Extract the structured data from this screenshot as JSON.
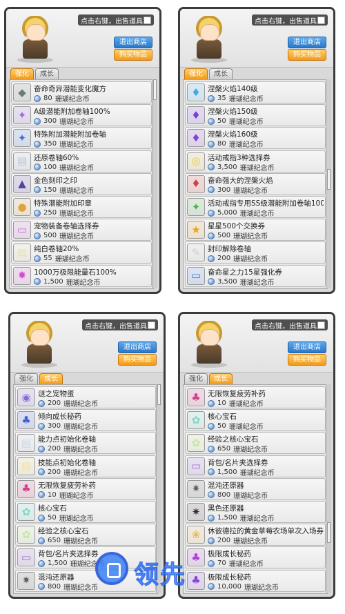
{
  "panels": [
    {
      "hint": "点击右键，出售道具",
      "exit_label": "退出商店",
      "buy_label": "购买物品",
      "tabs": [
        "强化",
        "成长"
      ],
      "active_tab": 0,
      "items": [
        {
          "name": "奋命奇异潜能变化魔方",
          "price": "80",
          "currency": "珊瑚纪念币",
          "icon": "cube-icon",
          "color": "#6b7c7a",
          "glyph": "◆"
        },
        {
          "name": "A级潜能附加卷轴100%",
          "price": "300",
          "currency": "珊瑚纪念币",
          "icon": "scroll-icon",
          "color": "#9b6bd6",
          "glyph": "✦"
        },
        {
          "name": "特殊附加潜能附加卷轴",
          "price": "350",
          "currency": "珊瑚纪念币",
          "icon": "scroll-icon",
          "color": "#3f6fd6",
          "glyph": "✦"
        },
        {
          "name": "还原卷轴60%",
          "price": "100",
          "currency": "珊瑚纪念币",
          "icon": "scroll-icon",
          "color": "#b9c4d8",
          "glyph": "▤"
        },
        {
          "name": "金色刻印之印",
          "price": "150",
          "currency": "珊瑚纪念币",
          "icon": "stamp-icon",
          "color": "#5a3fa0",
          "glyph": "▲"
        },
        {
          "name": "特殊潜能附加印章",
          "price": "250",
          "currency": "珊瑚纪念币",
          "icon": "stamp-icon",
          "color": "#e0a23c",
          "glyph": "●"
        },
        {
          "name": "宠物装备卷轴选择券",
          "price": "500",
          "currency": "珊瑚纪念币",
          "icon": "ticket-icon",
          "color": "#c86bd6",
          "glyph": "▭"
        },
        {
          "name": "纯白卷轴20%",
          "price": "55",
          "currency": "珊瑚纪念币",
          "icon": "scroll-icon",
          "color": "#e6e0b0",
          "glyph": "▤"
        },
        {
          "name": "1000万极限能量石100%",
          "price": "1,500",
          "currency": "珊瑚纪念币",
          "icon": "gem-icon",
          "color": "#d04fd0",
          "glyph": "✸"
        }
      ]
    },
    {
      "hint": "点击右键，出售道具",
      "exit_label": "退出商店",
      "buy_label": "购买物品",
      "tabs": [
        "强化",
        "成长"
      ],
      "active_tab": 0,
      "items": [
        {
          "name": "涅槃火焰140级",
          "price": "35",
          "currency": "珊瑚纪念币",
          "icon": "flame-icon",
          "color": "#3fa8e6",
          "glyph": "♦"
        },
        {
          "name": "涅槃火焰150级",
          "price": "50",
          "currency": "珊瑚纪念币",
          "icon": "flame-icon",
          "color": "#7a3fd6",
          "glyph": "♦"
        },
        {
          "name": "涅槃火焰160级",
          "price": "80",
          "currency": "珊瑚纪念币",
          "icon": "flame-icon",
          "color": "#8a3fd6",
          "glyph": "♦"
        },
        {
          "name": "活动戒指3种选择券",
          "price": "3,500",
          "currency": "珊瑚纪念币",
          "icon": "ring-ticket-icon",
          "color": "#e6c84f",
          "glyph": "◎"
        },
        {
          "name": "奋命强大的涅槃火焰",
          "price": "300",
          "currency": "珊瑚纪念币",
          "icon": "flame-icon",
          "color": "#d63f3f",
          "glyph": "♦"
        },
        {
          "name": "活动戒指专用SS级潜能附加卷轴100%",
          "price": "5,000",
          "currency": "珊瑚纪念币",
          "icon": "scroll-icon",
          "color": "#4fb04f",
          "glyph": "✦"
        },
        {
          "name": "星星500个交换券",
          "price": "500",
          "currency": "珊瑚纪念币",
          "icon": "star-icon",
          "color": "#f0a020",
          "glyph": "★"
        },
        {
          "name": "封印解除卷轴",
          "price": "200",
          "currency": "珊瑚纪念币",
          "icon": "scroll-icon",
          "color": "#d0d0d0",
          "glyph": "✎"
        },
        {
          "name": "奋命星之力15星强化券",
          "price": "3,500",
          "currency": "珊瑚纪念币",
          "icon": "ticket-icon",
          "color": "#3f7fd6",
          "glyph": "▭"
        }
      ]
    },
    {
      "hint": "点击右键，出售道具",
      "exit_label": "退出商店",
      "buy_label": "购买物品",
      "tabs": [
        "强化",
        "成长"
      ],
      "active_tab": 1,
      "items": [
        {
          "name": "谜之宠物蛋",
          "price": "200",
          "currency": "珊瑚纪念币",
          "icon": "egg-icon",
          "color": "#8a6bd6",
          "glyph": "◉"
        },
        {
          "name": "倾向成长秘药",
          "price": "300",
          "currency": "珊瑚纪念币",
          "icon": "potion-icon",
          "color": "#3f5fd6",
          "glyph": "♣"
        },
        {
          "name": "能力点初始化卷轴",
          "price": "200",
          "currency": "珊瑚纪念币",
          "icon": "scroll-icon",
          "color": "#c9d8e6",
          "glyph": "▤"
        },
        {
          "name": "技能点初始化卷轴",
          "price": "200",
          "currency": "珊瑚纪念币",
          "icon": "scroll-icon",
          "color": "#f0e0a0",
          "glyph": "▤"
        },
        {
          "name": "无限恢复疲劳补药",
          "price": "10",
          "currency": "珊瑚纪念币",
          "icon": "potion-icon",
          "color": "#d63f8a",
          "glyph": "♣"
        },
        {
          "name": "核心宝石",
          "price": "50",
          "currency": "珊瑚纪念币",
          "icon": "gem-icon",
          "color": "#7fd6c8",
          "glyph": "✿"
        },
        {
          "name": "经验之核心宝石",
          "price": "650",
          "currency": "珊瑚纪念币",
          "icon": "gem-icon",
          "color": "#c8e6a0",
          "glyph": "✿"
        },
        {
          "name": "背包/名片夹选择券",
          "price": "1,500",
          "currency": "珊瑚纪念币",
          "icon": "ticket-icon",
          "color": "#a06bd6",
          "glyph": "▭"
        },
        {
          "name": "混沌还原器",
          "price": "800",
          "currency": "珊瑚纪念币",
          "icon": "orb-icon",
          "color": "#5a5a5a",
          "glyph": "✷"
        }
      ]
    },
    {
      "hint": "点击右键，出售道具",
      "exit_label": "退出商店",
      "buy_label": "购买物品",
      "tabs": [
        "强化",
        "成长"
      ],
      "active_tab": 1,
      "items": [
        {
          "name": "无限恢复疲劳补药",
          "price": "10",
          "currency": "珊瑚纪念币",
          "icon": "potion-icon",
          "color": "#d63f8a",
          "glyph": "♣"
        },
        {
          "name": "核心宝石",
          "price": "50",
          "currency": "珊瑚纪念币",
          "icon": "gem-icon",
          "color": "#7fd6c8",
          "glyph": "✿"
        },
        {
          "name": "经验之核心宝石",
          "price": "650",
          "currency": "珊瑚纪念币",
          "icon": "gem-icon",
          "color": "#c8e6a0",
          "glyph": "✿"
        },
        {
          "name": "背包/名片夹选择券",
          "price": "1,500",
          "currency": "珊瑚纪念币",
          "icon": "ticket-icon",
          "color": "#a06bd6",
          "glyph": "▭"
        },
        {
          "name": "混沌还原器",
          "price": "800",
          "currency": "珊瑚纪念币",
          "icon": "orb-icon",
          "color": "#5a5a5a",
          "glyph": "✷"
        },
        {
          "name": "黑色还原器",
          "price": "1,500",
          "currency": "珊瑚纪念币",
          "icon": "orb-icon",
          "color": "#3a2a3a",
          "glyph": "✷"
        },
        {
          "name": "休彼德拉的黄金草莓农场单次入场券",
          "price": "200",
          "currency": "珊瑚纪念币",
          "icon": "ticket-icon",
          "color": "#e6b84f",
          "glyph": "❀"
        },
        {
          "name": "极限成长秘药",
          "price": "70",
          "currency": "珊瑚纪念币",
          "icon": "potion-icon",
          "color": "#b03fd6",
          "glyph": "♣"
        },
        {
          "name": "极限成长秘药",
          "price": "10,000",
          "currency": "珊瑚纪念币",
          "icon": "potion-icon",
          "color": "#8a3fd6",
          "glyph": "♣"
        }
      ]
    }
  ],
  "watermark": "领先"
}
